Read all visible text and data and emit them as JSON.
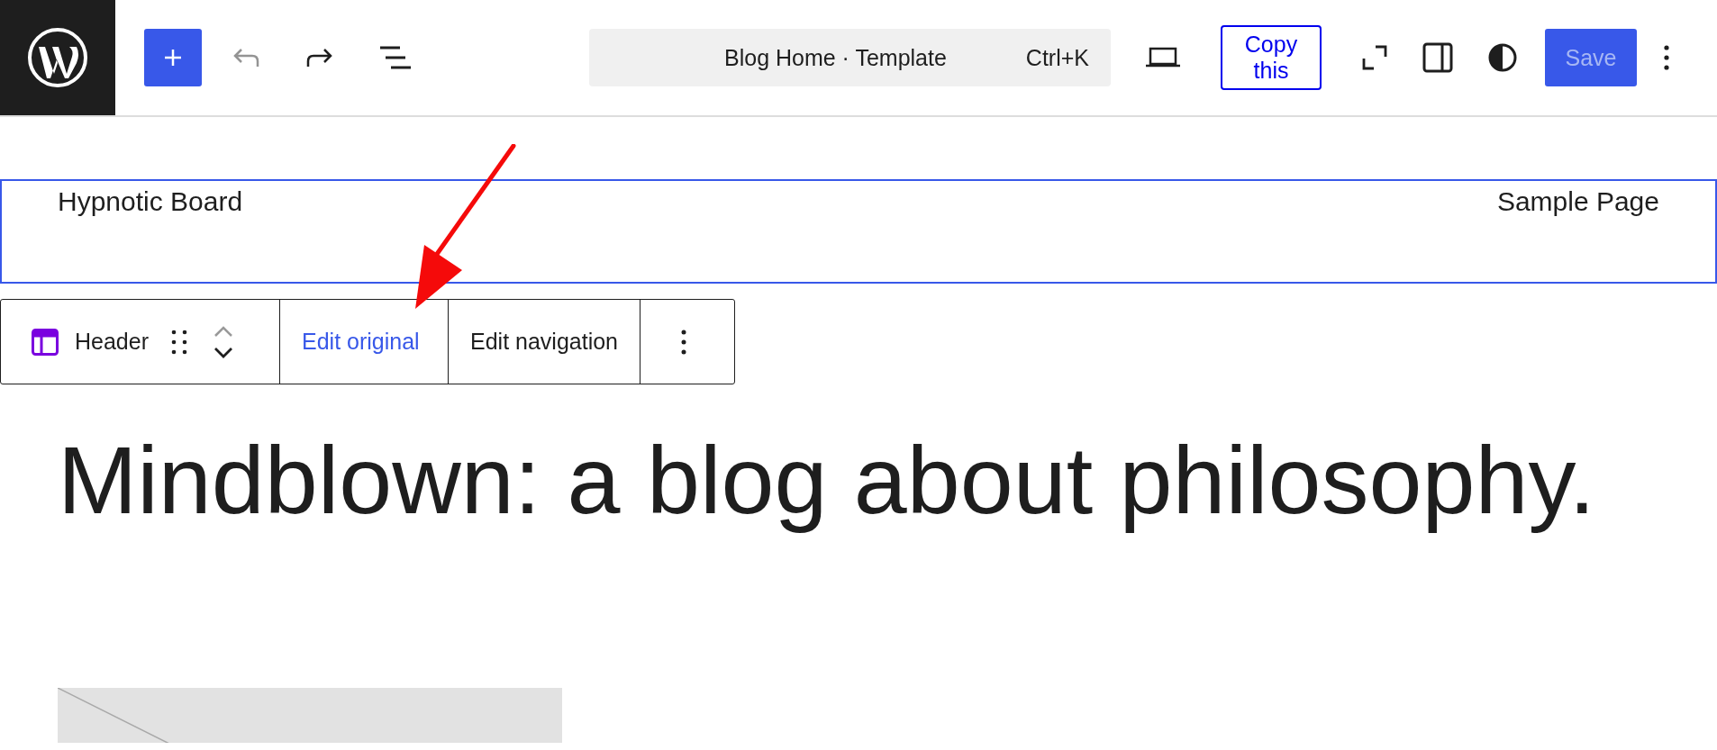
{
  "top_bar": {
    "tools": [
      {
        "kind": "add"
      },
      {
        "kind": "undo",
        "disabled": true
      },
      {
        "kind": "redo"
      },
      {
        "kind": "list"
      }
    ],
    "command_bar": {
      "title": "Blog Home · Template",
      "shortcut": "Ctrl+K"
    },
    "copy_button": "Copy this",
    "right_tools": [
      {
        "kind": "device"
      },
      {
        "kind": "copy"
      },
      {
        "kind": "fullscreen"
      },
      {
        "kind": "sidebar"
      },
      {
        "kind": "styles"
      },
      {
        "kind": "save",
        "label": "Save",
        "disabled": true
      },
      {
        "kind": "more"
      }
    ]
  },
  "header_block": {
    "selected": true,
    "site_title": "Hypnotic Board",
    "nav_link": "Sample Page"
  },
  "block_toolbar": {
    "block_name": "Header",
    "actions": [
      {
        "kind": "link",
        "label": "Edit original"
      },
      {
        "kind": "button",
        "label": "Edit navigation"
      }
    ]
  },
  "heading": "Mindblown: a blog about philosophy.",
  "featured_image": {
    "kind": "placeholder"
  }
}
